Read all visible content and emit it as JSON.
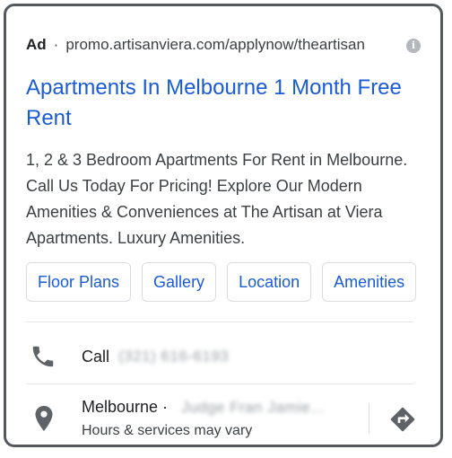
{
  "ad": {
    "label": "Ad",
    "separator": "·",
    "url": "promo.artisanviera.com/applynow/theartisan",
    "info_icon": "info-icon"
  },
  "headline": "Apartments In Melbourne 1 Month Free Rent",
  "description": "1, 2 & 3 Bedroom Apartments For Rent in Melbourne. Call Us Today For Pricing! Explore Our Modern Amenities & Conveniences at The Artisan at Viera Apartments. Luxury Amenities.",
  "sitelinks": [
    "Floor Plans",
    "Gallery",
    "Location",
    "Amenities"
  ],
  "call": {
    "label": "Call",
    "number_redacted": "(321) 616-6193",
    "icon": "phone-icon"
  },
  "location": {
    "city": "Melbourne ·",
    "address_redacted": "Judge Fran Jamie...",
    "hours": "Hours & services may vary",
    "pin_icon": "map-pin-icon",
    "directions_icon": "directions-icon"
  },
  "colors": {
    "link": "#1a5bd6",
    "border": "#55595e",
    "icon_gray": "#5f6368"
  }
}
